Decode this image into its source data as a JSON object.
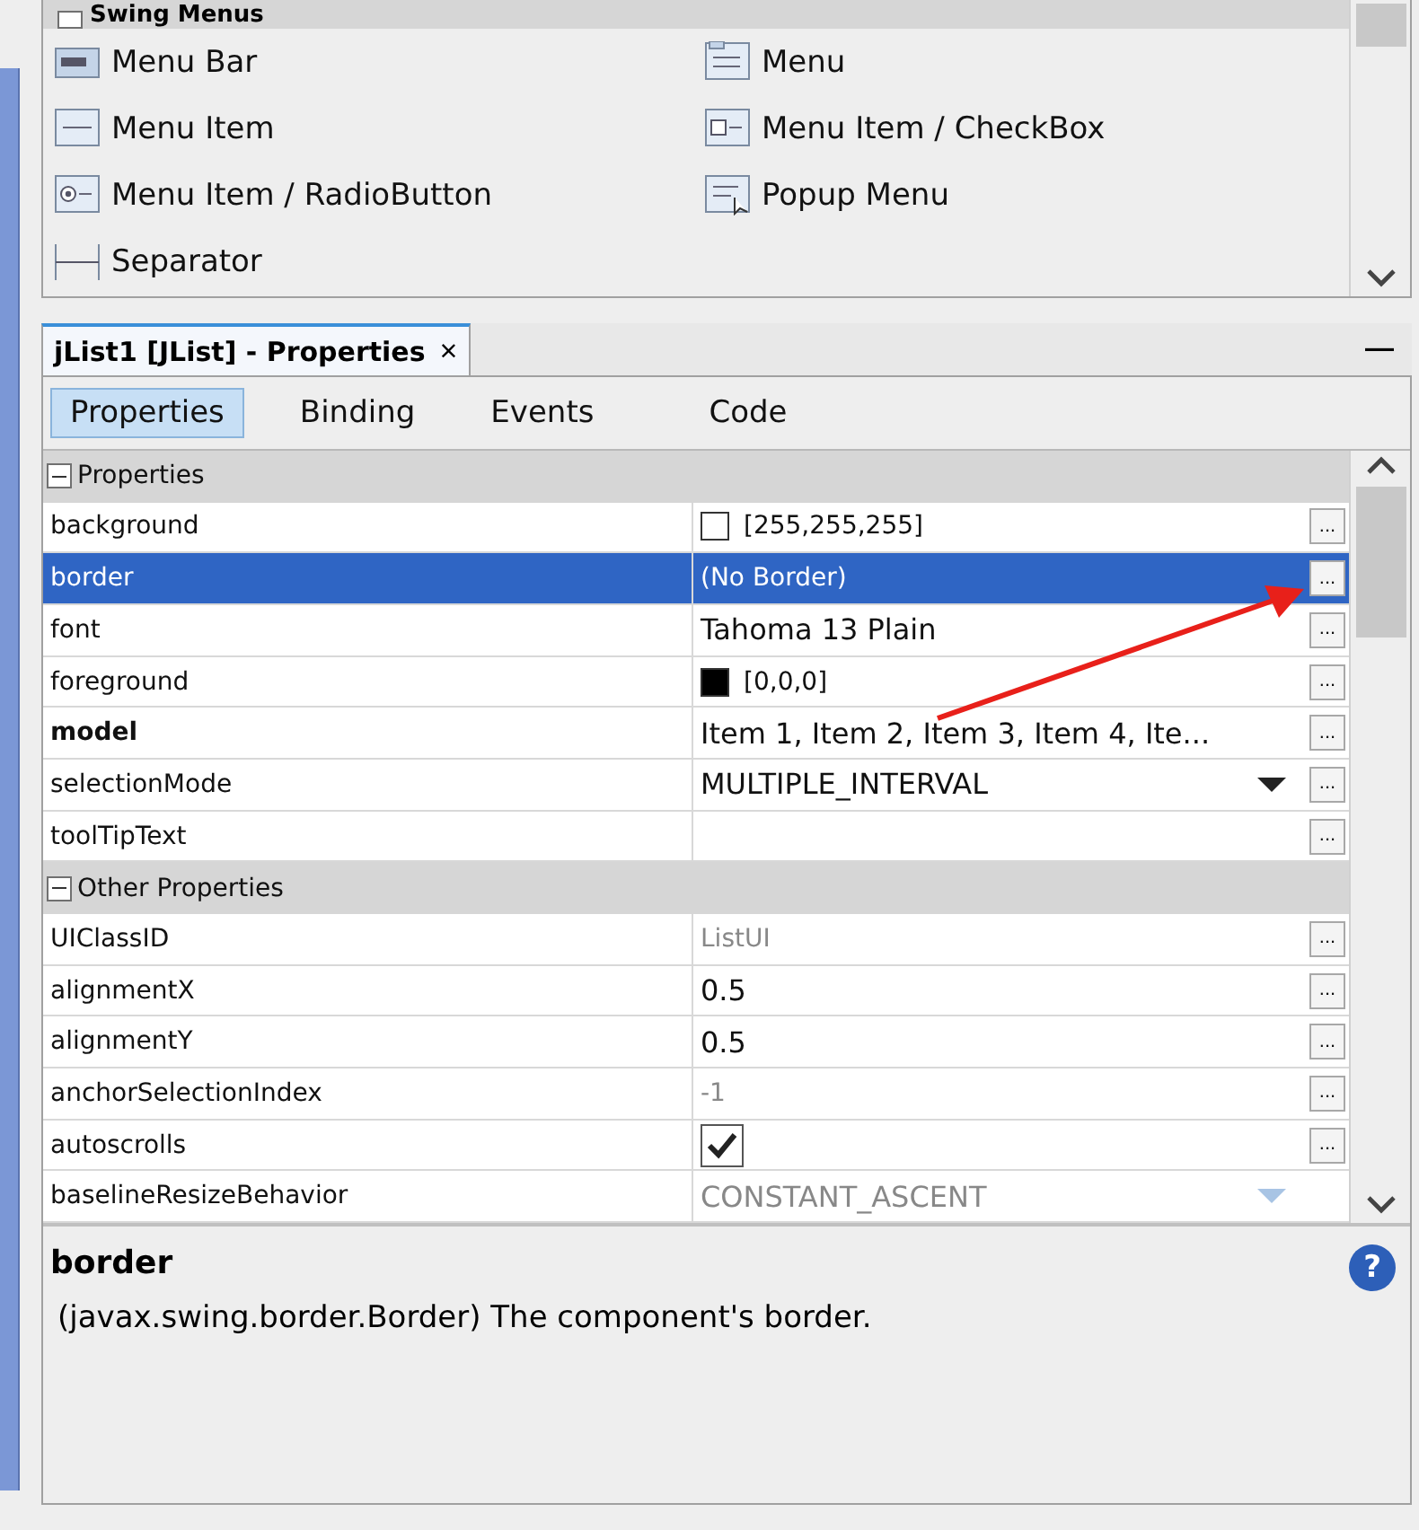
{
  "palette": {
    "category": {
      "label": "Swing Menus",
      "expanded": true
    },
    "items": [
      {
        "label": "Menu Bar",
        "kind": "menubar"
      },
      {
        "label": "Menu",
        "kind": "menu"
      },
      {
        "label": "Menu Item",
        "kind": "menuitem"
      },
      {
        "label": "Menu Item / CheckBox",
        "kind": "checkitem"
      },
      {
        "label": "Menu Item / RadioButton",
        "kind": "radioitem"
      },
      {
        "label": "Popup Menu",
        "kind": "popup"
      },
      {
        "label": "Separator",
        "kind": "separator"
      }
    ]
  },
  "properties_window": {
    "title": "jList1 [JList] - Properties",
    "close": "×",
    "minimize": "—",
    "tabs": [
      {
        "label": "Properties",
        "selected": true
      },
      {
        "label": "Binding",
        "selected": false
      },
      {
        "label": "Events",
        "selected": false
      },
      {
        "label": "Code",
        "selected": false
      }
    ],
    "sections": [
      {
        "label": "Properties",
        "expanded": true,
        "rows": [
          {
            "name": "background",
            "bold": false,
            "kind": "color",
            "color": "#ffffff",
            "value": "[255,255,255]",
            "selected": false,
            "button": "..."
          },
          {
            "name": "border",
            "bold": false,
            "kind": "label",
            "value": "(No Border)",
            "selected": true,
            "button": "..."
          },
          {
            "name": "font",
            "bold": false,
            "kind": "text",
            "value": "Tahoma 13 Plain",
            "selected": false,
            "button": "..."
          },
          {
            "name": "foreground",
            "bold": false,
            "kind": "color",
            "color": "#000000",
            "value": "[0,0,0]",
            "selected": false,
            "button": "..."
          },
          {
            "name": "model",
            "bold": true,
            "kind": "text",
            "value": "Item 1, Item 2, Item 3, Item 4, Ite...",
            "selected": false,
            "button": "..."
          },
          {
            "name": "selectionMode",
            "bold": false,
            "kind": "combo",
            "value": "MULTIPLE_INTERVAL",
            "selected": false,
            "button": "..."
          },
          {
            "name": "toolTipText",
            "bold": false,
            "kind": "label",
            "selected": false,
            "button": "..."
          }
        ]
      },
      {
        "label": "Other Properties",
        "expanded": true,
        "rows": [
          {
            "name": "UIClassID",
            "bold": false,
            "kind": "readonly",
            "value": "ListUI",
            "selected": false,
            "button": "..."
          },
          {
            "name": "alignmentX",
            "bold": false,
            "kind": "text",
            "value": "0.5",
            "selected": false,
            "button": "..."
          },
          {
            "name": "alignmentY",
            "bold": false,
            "kind": "text",
            "value": "0.5",
            "selected": false,
            "button": "..."
          },
          {
            "name": "anchorSelectionIndex",
            "bold": false,
            "kind": "readonly",
            "value": "-1",
            "selected": false,
            "button": "..."
          },
          {
            "name": "autoscrolls",
            "bold": false,
            "kind": "check",
            "checked": true,
            "selected": false,
            "button": "..."
          },
          {
            "name": "baselineResizeBehavior",
            "bold": false,
            "kind": "readonly_combo",
            "value": "CONSTANT_ASCENT",
            "selected": false
          }
        ]
      }
    ],
    "description": {
      "title": "border",
      "help": "?",
      "text": "(javax.swing.border.Border) The component's border."
    }
  }
}
